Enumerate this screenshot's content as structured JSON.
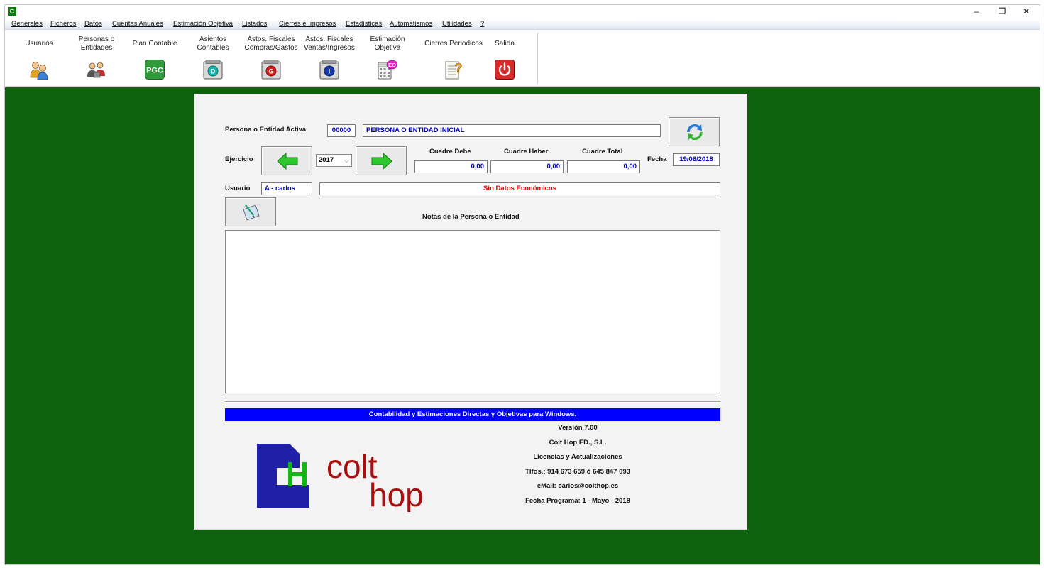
{
  "window": {
    "app_icon_letter": "C",
    "minimize": "–",
    "restore": "❐",
    "close": "✕"
  },
  "menu": [
    {
      "label": "Generales"
    },
    {
      "label": "Ficheros"
    },
    {
      "label": "Datos"
    },
    {
      "label": "Cuentas Anuales"
    },
    {
      "label": "Estimación Objetiva"
    },
    {
      "label": "Listados"
    },
    {
      "label": "Cierres e Impresos"
    },
    {
      "label": "Estadísticas"
    },
    {
      "label": "Automatismos"
    },
    {
      "label": "Utilidades"
    },
    {
      "label": "?"
    }
  ],
  "toolbar": [
    {
      "label": "Usuarios",
      "icon": "users-icon"
    },
    {
      "label": "Personas o\nEntidades",
      "icon": "entities-icon"
    },
    {
      "label": "Plan Contable",
      "icon": "pgc-icon",
      "icon_text": "PGC"
    },
    {
      "label": "Asientos\nContables",
      "icon": "journal-entries-icon",
      "icon_text": "D"
    },
    {
      "label": "Astos. Fiscales\nCompras/Gastos",
      "icon": "purchases-icon",
      "icon_text": "G"
    },
    {
      "label": "Astos. Fiscales\nVentas/Ingresos",
      "icon": "sales-icon",
      "icon_text": "I"
    },
    {
      "label": "Estimación\nObjetiva",
      "icon": "calculator-icon",
      "icon_text": "EO"
    },
    {
      "label": "Cierres Periodicos",
      "icon": "notepad-question-icon",
      "icon_text": "?"
    },
    {
      "label": "Salida",
      "icon": "power-icon"
    }
  ],
  "form": {
    "entity_label": "Persona o Entidad Activa",
    "entity_code": "00000",
    "entity_name": "PERSONA O ENTIDAD INICIAL",
    "ejercicio_label": "Ejercicio",
    "year_selected": "2017",
    "cuadre_debe_label": "Cuadre Debe",
    "cuadre_haber_label": "Cuadre Haber",
    "cuadre_total_label": "Cuadre Total",
    "cuadre_debe": "0,00",
    "cuadre_haber": "0,00",
    "cuadre_total": "0,00",
    "fecha_label": "Fecha",
    "fecha": "19/06/2018",
    "usuario_label": "Usuario",
    "usuario": "A - carlos",
    "status": "Sin Datos Económicos",
    "notes_label": "Notas de la Persona o Entidad",
    "notes": ""
  },
  "footer": {
    "banner": "Contabilidad y Estimaciones Directas y Objetivas para Windows.",
    "version": "Versión 7.00",
    "company": "Colt Hop ED., S.L.",
    "licenses": "Licencias y Actualizaciones",
    "phones": "Tlfos.: 914 673 659 ó 645 847 093",
    "email": "eMail: carlos@colthop.es",
    "program_date": "Fecha Programa:  1 - Mayo - 2018",
    "logo_word1": "colt",
    "logo_word2": "hop",
    "logo_letter": "H"
  },
  "colors": {
    "desktop": "#0e620e",
    "banner": "#0000ff",
    "field_text": "#0000c8",
    "status_text": "#e00000",
    "logo_blue": "#1f1fa8",
    "logo_red": "#a80f0f",
    "logo_green": "#14b814"
  }
}
